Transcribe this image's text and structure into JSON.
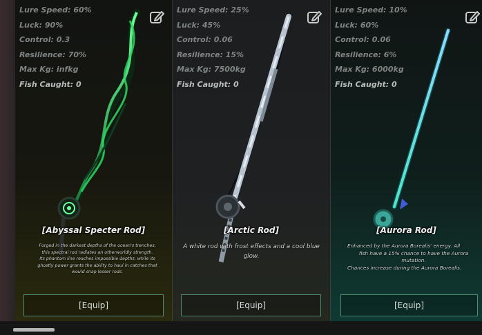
{
  "rods": [
    {
      "stats": {
        "lure_speed": "Lure Speed: 60%",
        "luck": "Luck: 90%",
        "control": "Control: 0.3",
        "resilience": "Resilience: 70%",
        "max_kg": "Max Kg: infkg",
        "fish_caught": "Fish Caught: 0"
      },
      "name": "[Abyssal Specter Rod]",
      "description_lines": [
        "Forged in the darkest depths of the ocean's trenches,",
        "this spectral rod radiates an otherworldly strength.",
        "Its phantom line reaches impossible depths, while its",
        "ghostly power grants the ability to haul in catches that",
        "would snap lesser rods."
      ],
      "equip_label": "[Equip]",
      "accent_color": "#34e06a"
    },
    {
      "stats": {
        "lure_speed": "Lure Speed: 25%",
        "luck": "Luck: 45%",
        "control": "Control: 0.06",
        "resilience": "Resilience: 15%",
        "max_kg": "Max Kg: 7500kg",
        "fish_caught": "Fish Caught: 0"
      },
      "name": "[Arctic Rod]",
      "description_lines": [
        "A white rod with frost effects and a cool blue",
        "glow."
      ],
      "equip_label": "[Equip]",
      "accent_color": "#c9d3dc"
    },
    {
      "stats": {
        "lure_speed": "Lure Speed: 10%",
        "luck": "Luck: 60%",
        "control": "Control: 0.06",
        "resilience": "Resilience: 6%",
        "max_kg": "Max Kg: 6000kg",
        "fish_caught": "Fish Caught: 0"
      },
      "name": "[Aurora Rod]",
      "description_lines": [
        "Enhanced by the Aurora Borealis' energy. All",
        "fish have a 15% chance to have the Aurora",
        "mutation.",
        "Chances increase during the Aurora Borealis."
      ],
      "equip_label": "[Equip]",
      "accent_color": "#6ce6f0"
    }
  ],
  "icons": {
    "edit": "edit-icon"
  },
  "colors": {
    "equip_border": "#4f8a72",
    "stat_text": "#7f8583"
  }
}
